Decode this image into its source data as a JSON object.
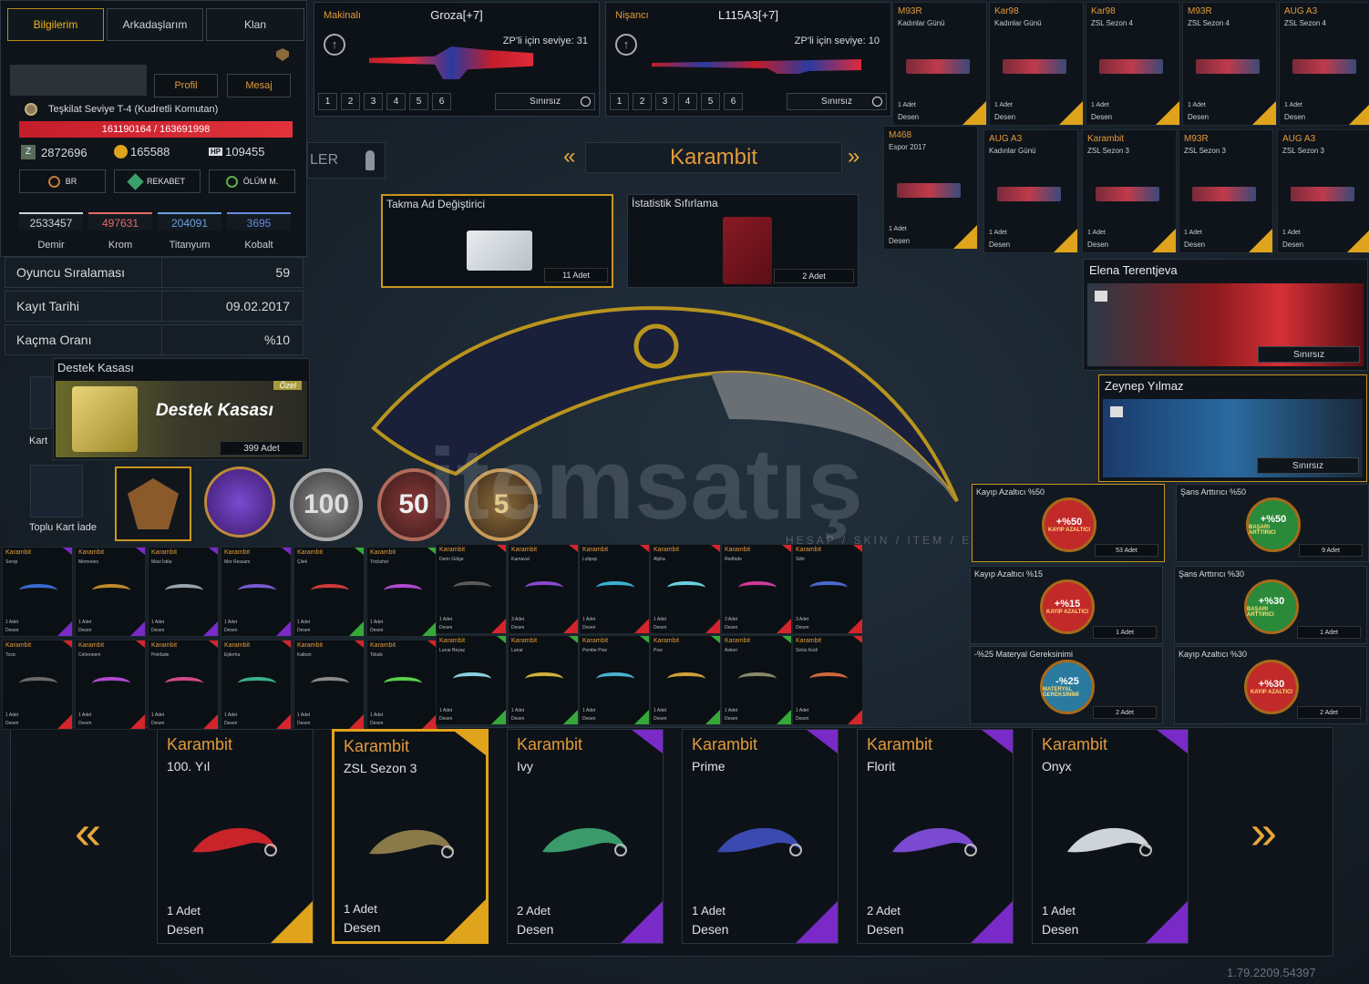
{
  "profile": {
    "tabs": [
      "Bilgilerim",
      "Arkadaşlarım",
      "Klan"
    ],
    "profile_btn": "Profil",
    "message_btn": "Mesaj",
    "rank_text": "Teşkilat Seviye T-4 (Kudretli Komutan)",
    "xp": "161190164 / 163691998",
    "currency": [
      {
        "icon": "Z",
        "value": "2872696"
      },
      {
        "icon": "●",
        "value": "165588"
      },
      {
        "icon": "HP",
        "value": "109455"
      }
    ],
    "stat_buttons": [
      "BR",
      "REKABET",
      "ÖLÜM M."
    ],
    "metals": [
      {
        "value": "2533457",
        "name": "Demir",
        "color": "#cfd4d9"
      },
      {
        "value": "497631",
        "name": "Krom",
        "color": "#e56a6a"
      },
      {
        "value": "204091",
        "name": "Titanyum",
        "color": "#6aa0e0"
      },
      {
        "value": "3695",
        "name": "Kobalt",
        "color": "#6a8ae0"
      }
    ],
    "rows": [
      {
        "k": "Oyuncu Sıralaması",
        "v": "59"
      },
      {
        "k": "Kayıt Tarihi",
        "v": "09.02.2017"
      },
      {
        "k": "Kaçma Oranı",
        "v": "%10"
      }
    ]
  },
  "weapons": [
    {
      "cat": "Makinalı",
      "name": "Groza[+7]",
      "level": "ZP'li için seviye: 31",
      "slots": [
        "1",
        "2",
        "3",
        "4",
        "5",
        "6"
      ],
      "limit": "Sınırsız"
    },
    {
      "cat": "Nişancı",
      "name": "L115A3[+7]",
      "level": "ZP'li için seviye: 10",
      "slots": [
        "1",
        "2",
        "3",
        "4",
        "5",
        "6"
      ],
      "limit": "Sınırsız"
    }
  ],
  "skins_top": [
    {
      "t1": "M93R",
      "t2": "Kadınlar Günü",
      "b1": "1 Adet",
      "b2": "Desen"
    },
    {
      "t1": "Kar98",
      "t2": "Kadınlar Günü",
      "b1": "1 Adet",
      "b2": "Desen"
    },
    {
      "t1": "Kar98",
      "t2": "ZSL Sezon 4",
      "b1": "1 Adet",
      "b2": "Desen"
    },
    {
      "t1": "M93R",
      "t2": "ZSL Sezon 4",
      "b1": "1 Adet",
      "b2": "Desen"
    },
    {
      "t1": "AUG A3",
      "t2": "ZSL Sezon 4",
      "b1": "1 Adet",
      "b2": "Desen"
    },
    {
      "t1": "M468",
      "t2": "Espor 2017",
      "b1": "1 Adet",
      "b2": "Desen"
    },
    {
      "t1": "AUG A3",
      "t2": "Kadınlar Günü",
      "b1": "1 Adet",
      "b2": "Desen"
    },
    {
      "t1": "Karambit",
      "t2": "ZSL Sezon 3",
      "b1": "1 Adet",
      "b2": "Desen"
    },
    {
      "t1": "M93R",
      "t2": "ZSL Sezon 3",
      "b1": "1 Adet",
      "b2": "Desen"
    },
    {
      "t1": "AUG A3",
      "t2": "ZSL Sezon 3",
      "b1": "1 Adet",
      "b2": "Desen"
    }
  ],
  "center": {
    "title": "Karambit",
    "partial_tab": "LER",
    "items": [
      {
        "name": "Takma Ad Değiştirici",
        "count": "11 Adet"
      },
      {
        "name": "İstatistik Sıfırlama",
        "count": "2 Adet"
      }
    ],
    "crate": {
      "title": "Destek Kasası",
      "label": "Destek Kasası",
      "tag": "Özel",
      "count": "399 Adet"
    },
    "side_labels": [
      "Kart",
      "Toplu Kart İade"
    ],
    "medals": [
      "100",
      "50",
      "5"
    ],
    "watermark": "itemsatış",
    "watermark_sub": "HESAP / SKIN / ITEM / E-PIN"
  },
  "characters": [
    {
      "name": "Elena Terentjeva",
      "limit": "Sınırsız"
    },
    {
      "name": "Zeynep Yılmaz",
      "limit": "Sınırsız"
    }
  ],
  "buffs": [
    {
      "title": "Kayıp Azaltıcı %50",
      "big": "+%50",
      "small": "KAYIP AZALTICI",
      "count": "53 Adet",
      "color": "#c22a2a"
    },
    {
      "title": "Şans Arttırıcı %50",
      "big": "+%50",
      "small": "BAŞARI ARTTIRICI",
      "count": "9 Adet",
      "color": "#2a8a3a"
    },
    {
      "title": "Kayıp Azaltıcı %15",
      "big": "+%15",
      "small": "KAYIP AZALTICI",
      "count": "1 Adet",
      "color": "#c22a2a"
    },
    {
      "title": "Şans Arttırıcı %30",
      "big": "+%30",
      "small": "BAŞARI ARTTIRICI",
      "count": "1 Adet",
      "color": "#2a8a3a"
    },
    {
      "title": "-%25 Materyal Gereksinimi",
      "big": "-%25",
      "small": "MATERYAL GEREKSİNİMİ",
      "count": "2 Adet",
      "color": "#2a7aa0"
    },
    {
      "title": "Kayıp Azaltıcı %30",
      "big": "+%30",
      "small": "KAYIP AZALTICI",
      "count": "2 Adet",
      "color": "#c22a2a"
    }
  ],
  "mini_karambits": [
    {
      "t1": "Karambit",
      "t2": "Sorop",
      "b1": "1 Adet",
      "b2": "Desen",
      "c": "p",
      "blade": "#3a6ad0"
    },
    {
      "t1": "Karambit",
      "t2": "Memories",
      "b1": "1 Adet",
      "b2": "Desen",
      "c": "p",
      "blade": "#c08a2a"
    },
    {
      "t1": "Karambit",
      "t2": "Mavi İstila",
      "b1": "1 Adet",
      "b2": "Desen",
      "c": "p",
      "blade": "#9aa4ad"
    },
    {
      "t1": "Karambit",
      "t2": "Mor Ressam",
      "b1": "1 Adet",
      "b2": "Desen",
      "c": "p",
      "blade": "#7a5ad0"
    },
    {
      "t1": "Karambit",
      "t2": "Çilek",
      "b1": "1 Adet",
      "b2": "Desen",
      "c": "g",
      "blade": "#d03a3a"
    },
    {
      "t1": "Karambit",
      "t2": "Trickshot",
      "b1": "1 Adet",
      "b2": "Desen",
      "c": "g",
      "blade": "#b04ad0"
    },
    {
      "t1": "Karambit",
      "t2": "Derin Gölge",
      "b1": "1 Adet",
      "b2": "Desen",
      "c": "r",
      "blade": "#5a5a5a"
    },
    {
      "t1": "Karambit",
      "t2": "Karnaval",
      "b1": "3 Adet",
      "b2": "Desen",
      "c": "r",
      "blade": "#8a4ad0"
    },
    {
      "t1": "Karambit",
      "t2": "Lolipop",
      "b1": "1 Adet",
      "b2": "Desen",
      "c": "r",
      "blade": "#3ab0d0"
    },
    {
      "t1": "Karambit",
      "t2": "Alpha",
      "b1": "1 Adet",
      "b2": "Desen",
      "c": "r",
      "blade": "#6ad0e0"
    },
    {
      "t1": "Karambit",
      "t2": "Redfade",
      "b1": "3 Adet",
      "b2": "Desen",
      "c": "r",
      "blade": "#d03a9a"
    },
    {
      "t1": "Karambit",
      "t2": "Sihir",
      "b1": "3 Adet",
      "b2": "Desen",
      "c": "r",
      "blade": "#4a6ad0"
    },
    {
      "t1": "Karambit",
      "t2": "Toxic",
      "b1": "1 Adet",
      "b2": "Desen",
      "c": "r",
      "blade": "#6a6a6a"
    },
    {
      "t1": "Karambit",
      "t2": "Cehennem",
      "b1": "1 Adet",
      "b2": "Desen",
      "c": "r",
      "blade": "#b04ad0"
    },
    {
      "t1": "Karambit",
      "t2": "Pinkfade",
      "b1": "1 Adet",
      "b2": "Desen",
      "c": "r",
      "blade": "#d04a8a"
    },
    {
      "t1": "Karambit",
      "t2": "Ejderha",
      "b1": "1 Adet",
      "b2": "Desen",
      "c": "r",
      "blade": "#3ab08a"
    },
    {
      "t1": "Karambit",
      "t2": "Kalbon",
      "b1": "1 Adet",
      "b2": "Desen",
      "c": "r",
      "blade": "#8a8a8a"
    },
    {
      "t1": "Karambit",
      "t2": "Toksik",
      "b1": "1 Adet",
      "b2": "Desen",
      "c": "r",
      "blade": "#5ad04a"
    },
    {
      "t1": "Karambit",
      "t2": "Lunar Beyaz",
      "b1": "1 Adet",
      "b2": "Desen",
      "c": "g",
      "blade": "#8ad0e0"
    },
    {
      "t1": "Karambit",
      "t2": "Lunar",
      "b1": "1 Adet",
      "b2": "Desen",
      "c": "g",
      "blade": "#d0b03a"
    },
    {
      "t1": "Karambit",
      "t2": "Pembe Pow",
      "b1": "1 Adet",
      "b2": "Desen",
      "c": "g",
      "blade": "#4ab0d0"
    },
    {
      "t1": "Karambit",
      "t2": "Pow",
      "b1": "1 Adet",
      "b2": "Desen",
      "c": "g",
      "blade": "#d0a03a"
    },
    {
      "t1": "Karambit",
      "t2": "Askeri",
      "b1": "1 Adet",
      "b2": "Desen",
      "c": "g",
      "blade": "#8a8a6a"
    },
    {
      "t1": "Karambit",
      "t2": "Siriüs Kedi",
      "b1": "1 Adet",
      "b2": "Desen",
      "c": "r",
      "blade": "#d06a3a"
    }
  ],
  "big_cards": [
    {
      "n1": "Karambit",
      "n2": "100. Yıl",
      "c1": "1 Adet",
      "c2": "Desen",
      "c": "",
      "blade": "#c8242a"
    },
    {
      "n1": "Karambit",
      "n2": "ZSL Sezon 3",
      "c1": "1 Adet",
      "c2": "Desen",
      "c": "",
      "blade": "#8a7a4a"
    },
    {
      "n1": "Karambit",
      "n2": "Ivy",
      "c1": "2 Adet",
      "c2": "Desen",
      "c": "p",
      "blade": "#3a9a6a"
    },
    {
      "n1": "Karambit",
      "n2": "Prime",
      "c1": "1 Adet",
      "c2": "Desen",
      "c": "p",
      "blade": "#3a4ab0"
    },
    {
      "n1": "Karambit",
      "n2": "Florit",
      "c1": "2 Adet",
      "c2": "Desen",
      "c": "p",
      "blade": "#7a4ad0"
    },
    {
      "n1": "Karambit",
      "n2": "Onyx",
      "c1": "1 Adet",
      "c2": "Desen",
      "c": "p",
      "blade": "#cfd4d9"
    }
  ],
  "version": "1.79.2209.54397"
}
